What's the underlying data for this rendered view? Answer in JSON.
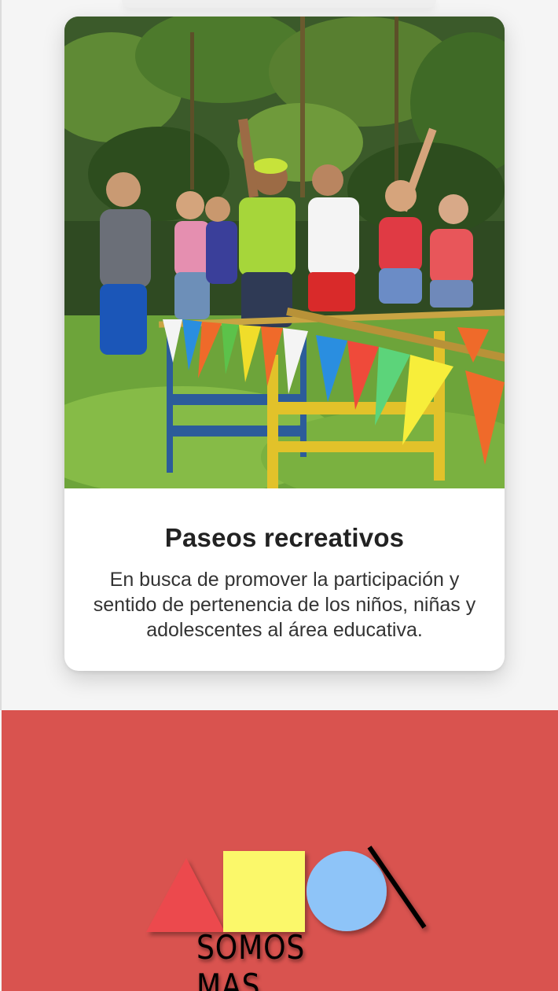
{
  "card": {
    "title": "Paseos recreativos",
    "description": "En busca de promover la participación y sentido de pertenencia de los niños, niñas y adolescentes al área educativa.",
    "photo_icon": "group-photo"
  },
  "footer": {
    "logo_text": "SOMOS MAS",
    "logo_icon": "shapes-logo-icon",
    "background_color": "#d9534f"
  }
}
